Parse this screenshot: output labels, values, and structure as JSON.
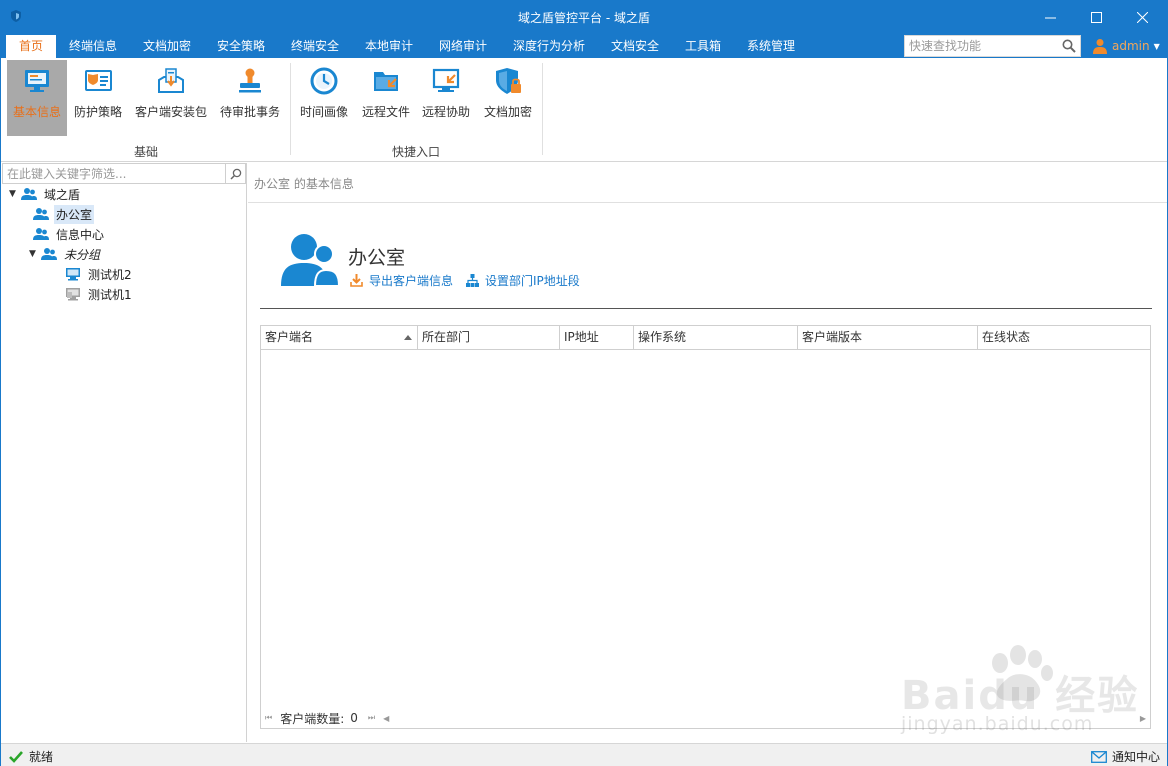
{
  "window": {
    "title": "域之盾管控平台 - 域之盾"
  },
  "menu": {
    "tabs": [
      "首页",
      "终端信息",
      "文档加密",
      "安全策略",
      "终端安全",
      "本地审计",
      "网络审计",
      "深度行为分析",
      "文档安全",
      "工具箱",
      "系统管理"
    ],
    "active_tab": "首页",
    "search_placeholder": "快速查找功能",
    "user": "admin"
  },
  "ribbon": {
    "groups": [
      {
        "label": "基础",
        "buttons": [
          {
            "label": "基本信息",
            "icon": "monitor-info-icon",
            "active": true
          },
          {
            "label": "防护策略",
            "icon": "shield-card-icon",
            "active": false
          },
          {
            "label": "客户端安装包",
            "icon": "package-icon",
            "active": false
          },
          {
            "label": "待审批事务",
            "icon": "stamp-icon",
            "active": false
          }
        ]
      },
      {
        "label": "快捷入口",
        "buttons": [
          {
            "label": "时间画像",
            "icon": "clock-icon",
            "active": false
          },
          {
            "label": "远程文件",
            "icon": "folder-arrow-icon",
            "active": false
          },
          {
            "label": "远程协助",
            "icon": "remote-screen-icon",
            "active": false
          },
          {
            "label": "文档加密",
            "icon": "shield-lock-icon",
            "active": false
          }
        ]
      }
    ]
  },
  "tree": {
    "filter_placeholder": "在此键入关键字筛选...",
    "root": "域之盾",
    "children": [
      "办公室",
      "信息中心",
      "未分组"
    ],
    "ungrouped_children": [
      "测试机2",
      "测试机1"
    ],
    "selected": "办公室"
  },
  "detail": {
    "breadcrumb": "办公室 的基本信息",
    "dept_name": "办公室",
    "links": [
      "导出客户端信息",
      "设置部门IP地址段"
    ],
    "columns": [
      "客户端名",
      "所在部门",
      "IP地址",
      "操作系统",
      "客户端版本",
      "在线状态"
    ],
    "rows": [],
    "client_count_label": "客户端数量:",
    "client_count": "0"
  },
  "watermark": {
    "logo_text": "Baidu 经验",
    "url": "jingyan.baidu.com"
  },
  "status": {
    "left": "就绪",
    "right": "通知中心"
  },
  "colors": {
    "title_bar": "#1979ca",
    "accent_orange": "#e8701a",
    "icon_blue": "#1a87d1"
  }
}
